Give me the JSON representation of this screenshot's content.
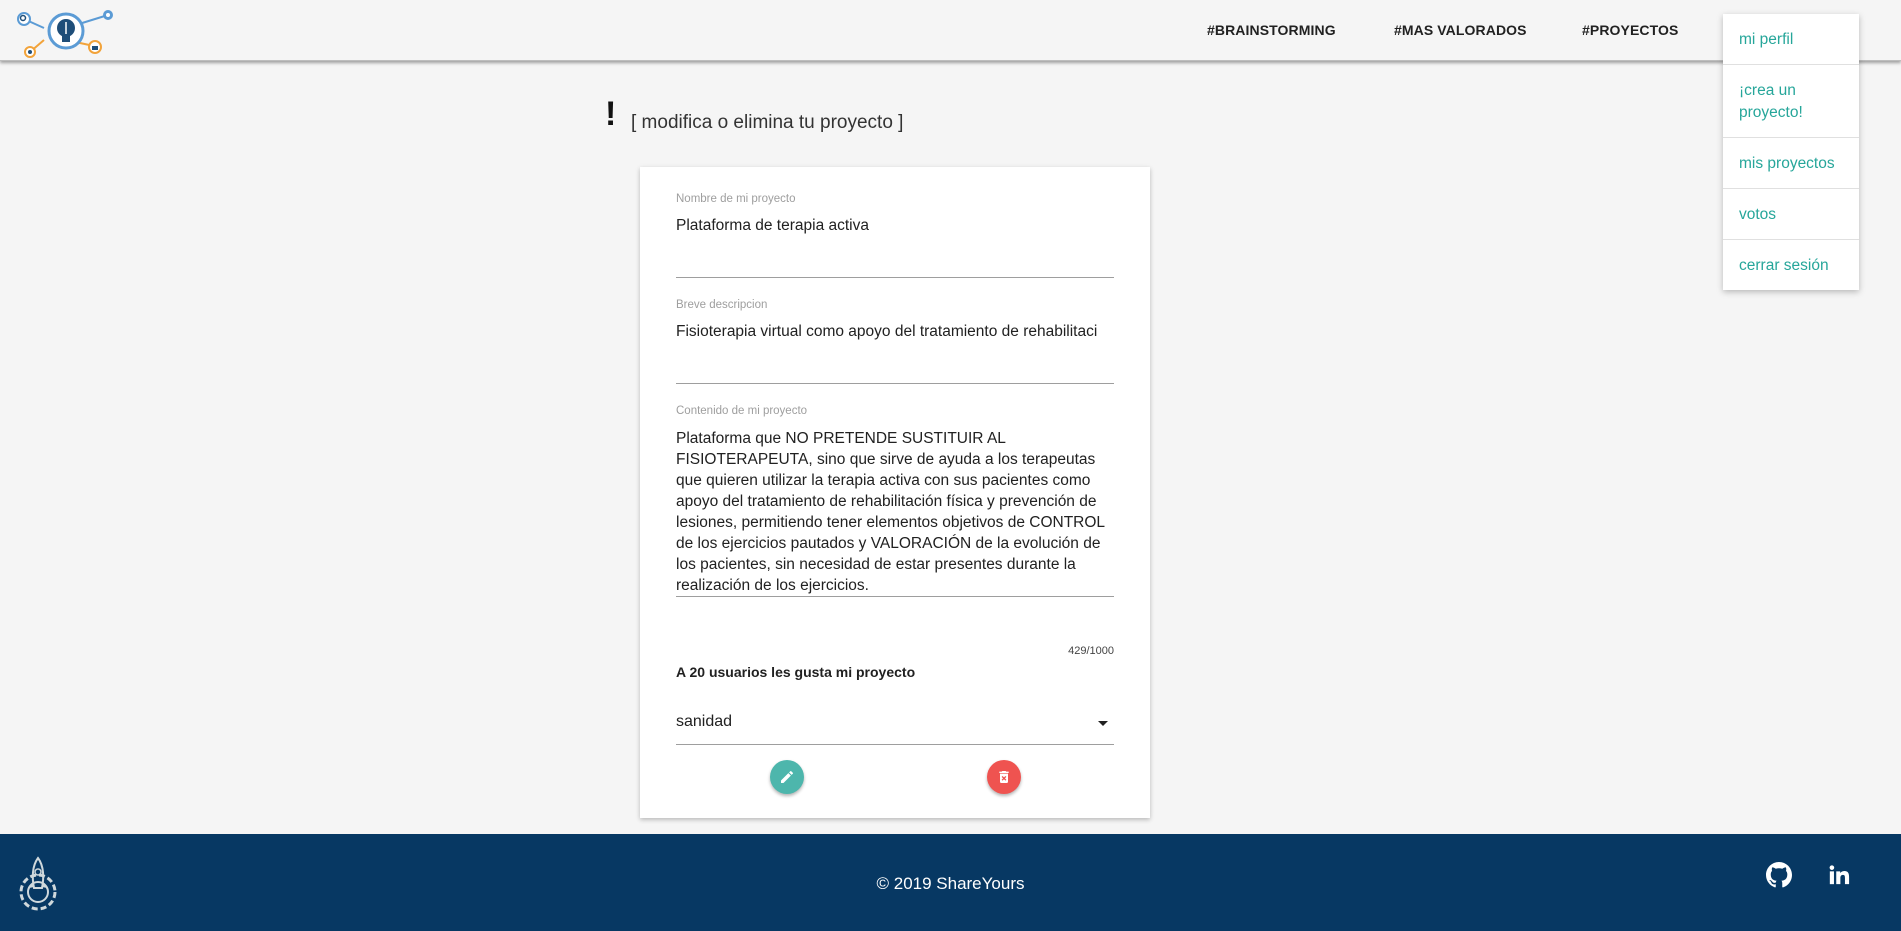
{
  "nav": {
    "links": [
      "#BRAINSTORMING",
      "#MAS VALORADOS",
      "#PROYECTOS"
    ]
  },
  "dropdown": {
    "items": [
      "mi perfil",
      "¡crea un proyecto!",
      "mis proyectos",
      "votos",
      "cerrar sesión"
    ]
  },
  "page": {
    "icon": "!",
    "heading": "[ modifica o elimina tu proyecto ]"
  },
  "form": {
    "name_label": "Nombre de mi proyecto",
    "name_value": "Plataforma de terapia activa",
    "desc_label": "Breve descripcion",
    "desc_value": "Fisioterapia virtual como apoyo del tratamiento de rehabilitaci",
    "content_label": "Contenido de mi proyecto",
    "content_value": "Plataforma que NO PRETENDE SUSTITUIR AL FISIOTERAPEUTA, sino que sirve de ayuda a los terapeutas que quieren utilizar la terapia activa con sus pacientes como apoyo del tratamiento de rehabilitación física y prevención de lesiones, permitiendo tener elementos objetivos de CONTROL de los ejercicios pautados y VALORACIÓN de la evolución de los pacientes, sin necesidad de estar presentes durante la realización de los ejercicios.",
    "counter": "429/1000",
    "likes": "A 20 usuarios les gusta mi proyecto",
    "category": "sanidad"
  },
  "footer": {
    "copyright": "© 2019 ShareYours"
  },
  "colors": {
    "accent": "#26a69a",
    "edit": "#4db6ac",
    "delete": "#ef5350",
    "footer": "#073863"
  },
  "icons": [
    "logo-icon",
    "edit-icon",
    "delete-icon",
    "rocket-gear-icon",
    "github-icon",
    "linkedin-icon"
  ]
}
